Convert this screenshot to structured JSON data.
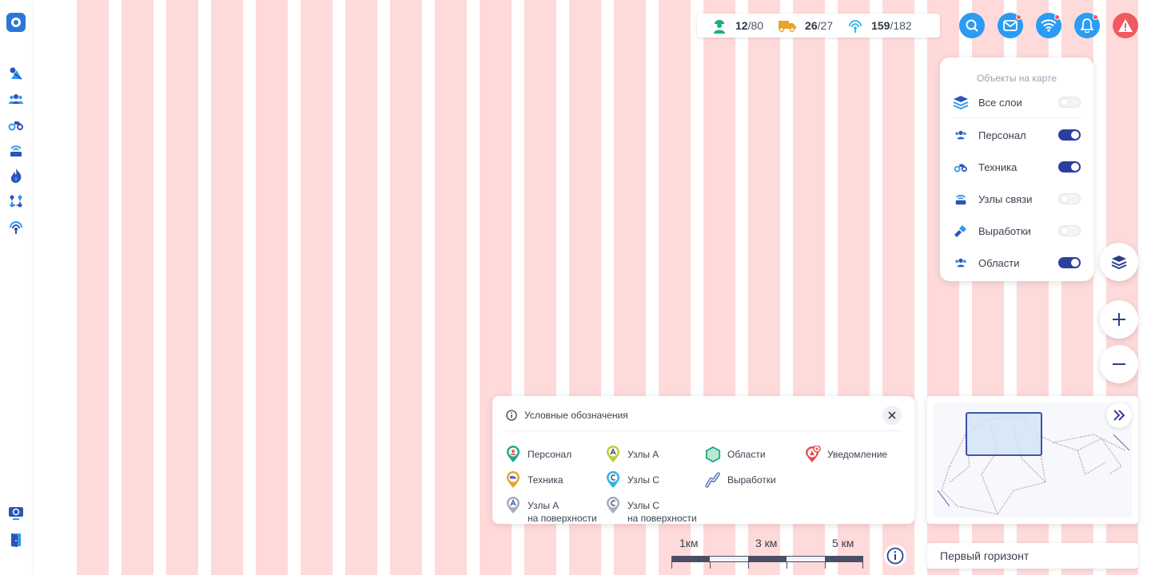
{
  "stats": {
    "personnel": {
      "current": "12",
      "total": "/80",
      "icon": "worker-icon"
    },
    "vehicles": {
      "current": "26",
      "total": "/27",
      "icon": "truck-icon"
    },
    "beacons": {
      "current": "159",
      "total": "/182",
      "icon": "signal-icon"
    }
  },
  "top_buttons": [
    {
      "name": "search-button",
      "icon": "search-icon",
      "badge": false
    },
    {
      "name": "messages-button",
      "icon": "mail-icon",
      "badge": true
    },
    {
      "name": "network-button",
      "icon": "wifi-icon",
      "badge": true
    },
    {
      "name": "notifications-button",
      "icon": "bell-icon",
      "badge": true
    },
    {
      "name": "alert-button",
      "icon": "warning-icon",
      "badge": false
    }
  ],
  "layers_panel": {
    "title": "Объекты на карте",
    "items": [
      {
        "label": "Все слои",
        "on": false,
        "icon": "layers-icon"
      },
      {
        "label": "Персонал",
        "on": true,
        "icon": "people-icon"
      },
      {
        "label": "Техника",
        "on": true,
        "icon": "vehicle-icon"
      },
      {
        "label": "Узлы связи",
        "on": false,
        "icon": "router-icon"
      },
      {
        "label": "Выработки",
        "on": false,
        "icon": "drill-icon"
      },
      {
        "label": "Области",
        "on": true,
        "icon": "areas-icon"
      }
    ]
  },
  "legend": {
    "title": "Условные обозначения",
    "items": [
      {
        "label": "Персонал",
        "label2": "",
        "icon": "personnel-marker-icon"
      },
      {
        "label": "Узлы А",
        "label2": "",
        "icon": "node-a-marker-icon"
      },
      {
        "label": "Области",
        "label2": "",
        "icon": "area-hexagon-icon"
      },
      {
        "label": "Уведомление",
        "label2": "",
        "icon": "notification-marker-icon"
      },
      {
        "label": "Техника",
        "label2": "",
        "icon": "vehicle-marker-icon"
      },
      {
        "label": "Узлы С",
        "label2": "",
        "icon": "node-c-marker-icon"
      },
      {
        "label": "Выработки",
        "label2": "",
        "icon": "tunnel-icon"
      },
      {
        "label": "Узлы А",
        "label2": "на поверхности",
        "icon": "surface-node-a-icon"
      },
      {
        "label": "Узлы С",
        "label2": "на поверхности",
        "icon": "surface-node-c-icon"
      }
    ]
  },
  "scale": {
    "labels": [
      "1км",
      "3 км",
      "5 км"
    ]
  },
  "horizon": {
    "value": "Первый горизонт"
  },
  "colors": {
    "accent": "#2b9bf4",
    "toggle_on": "#2b3f9e",
    "alert": "#f05a5f",
    "stripe": "#ffdada"
  }
}
